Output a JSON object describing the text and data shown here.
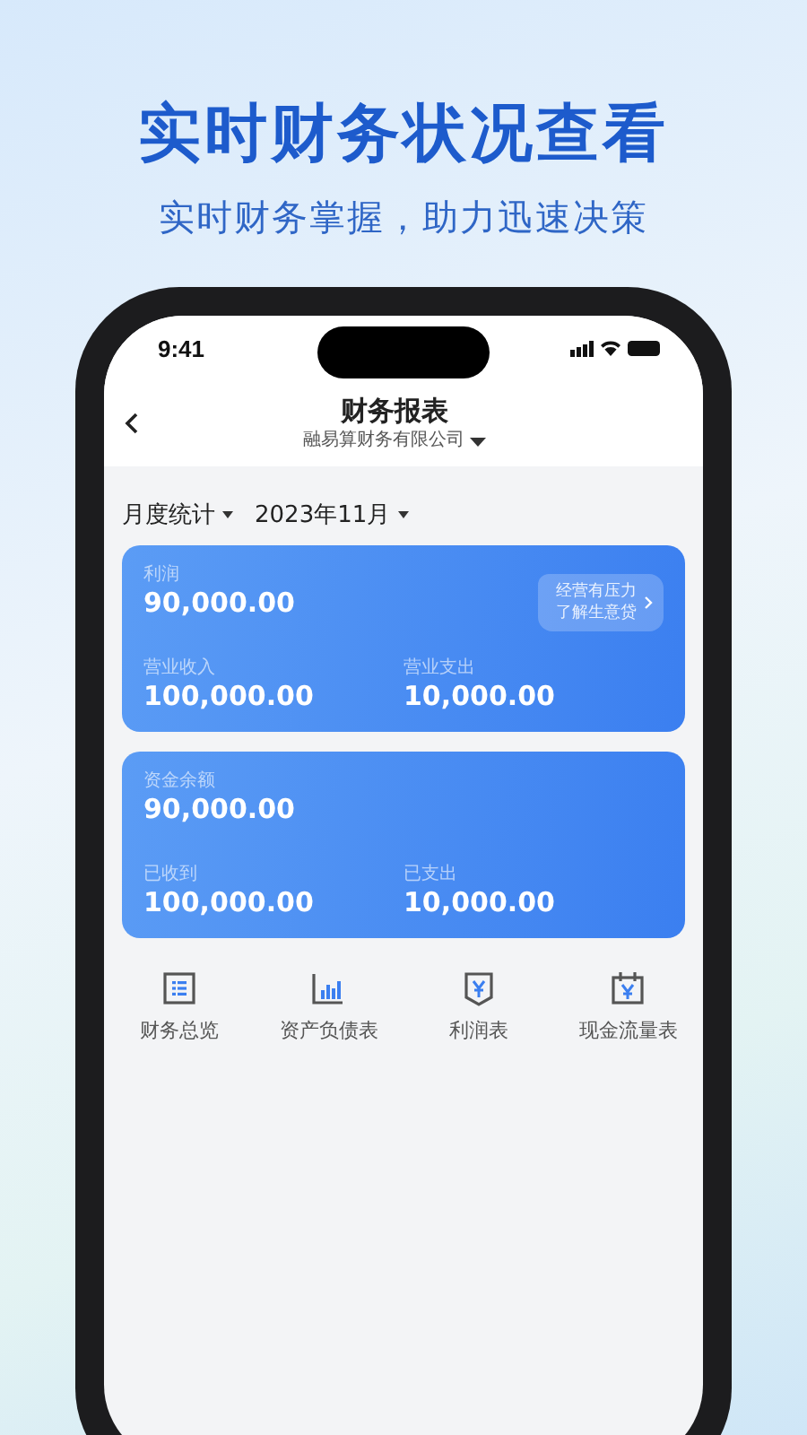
{
  "headline": "实时财务状况查看",
  "subheadline": "实时财务掌握，助力迅速决策",
  "status_bar": {
    "time": "9:41"
  },
  "nav": {
    "title": "财务报表",
    "company": "融易算财务有限公司"
  },
  "filters": [
    {
      "label": "月度统计"
    },
    {
      "label": "2023年11月"
    }
  ],
  "cards": [
    {
      "primary": {
        "label": "利润",
        "value": "90,000.00"
      },
      "promo": {
        "lines": [
          "经营有压力",
          "了解生意贷"
        ]
      },
      "items": [
        {
          "label": "营业收入",
          "value": "100,000.00"
        },
        {
          "label": "营业支出",
          "value": "10,000.00"
        }
      ]
    },
    {
      "primary": {
        "label": "资金余额",
        "value": "90,000.00"
      },
      "items": [
        {
          "label": "已收到",
          "value": "100,000.00"
        },
        {
          "label": "已支出",
          "value": "10,000.00"
        }
      ]
    }
  ],
  "shortcuts": [
    {
      "label": "财务总览",
      "kind": "list"
    },
    {
      "label": "资产负债表",
      "kind": "bars"
    },
    {
      "label": "利润表",
      "kind": "yen-shield"
    },
    {
      "label": "现金流量表",
      "kind": "yen-calendar"
    }
  ]
}
